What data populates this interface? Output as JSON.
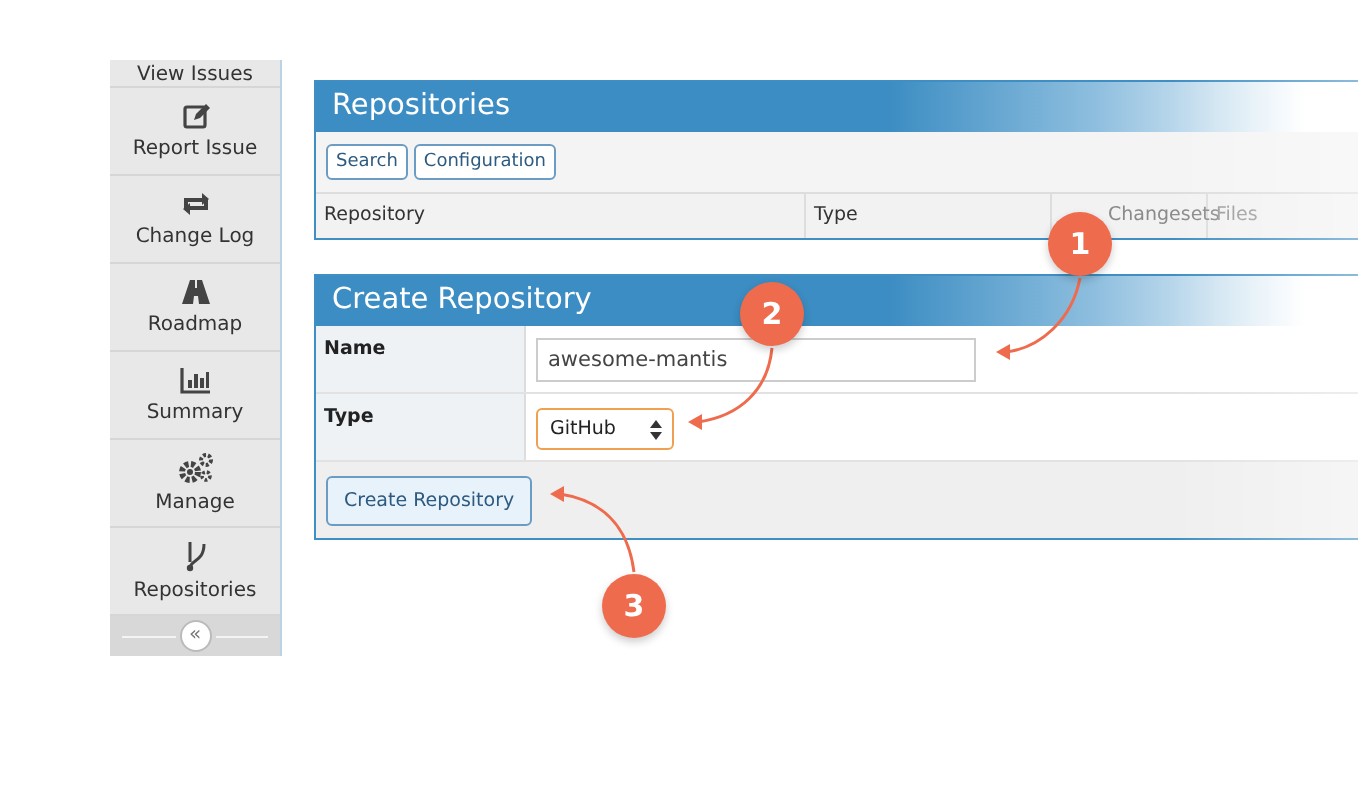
{
  "sidebar": {
    "items": [
      {
        "label": "View Issues"
      },
      {
        "label": "Report Issue"
      },
      {
        "label": "Change Log"
      },
      {
        "label": "Roadmap"
      },
      {
        "label": "Summary"
      },
      {
        "label": "Manage"
      },
      {
        "label": "Repositories"
      }
    ],
    "collapse": "«"
  },
  "repositories": {
    "title": "Repositories",
    "buttons": [
      "Search",
      "Configuration"
    ],
    "columns": [
      "Repository",
      "Type",
      "Changesets",
      "Files"
    ]
  },
  "create_repository": {
    "title": "Create Repository",
    "fields": [
      {
        "label": "Name",
        "kind": "text",
        "value": "awesome-mantis"
      },
      {
        "label": "Type",
        "kind": "select",
        "value": "GitHub"
      }
    ],
    "submit": "Create Repository"
  },
  "callouts": [
    "1",
    "2",
    "3"
  ]
}
